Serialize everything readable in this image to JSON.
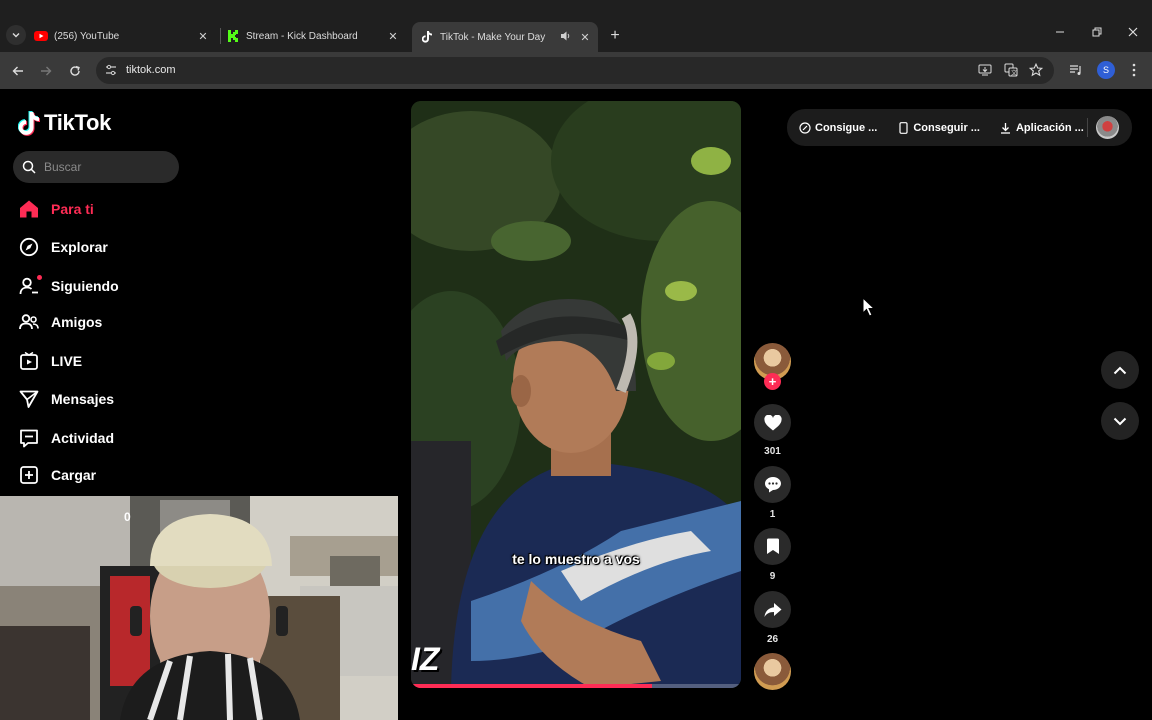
{
  "browser": {
    "tabs": [
      {
        "title": "(256) YouTube",
        "favicon": "youtube-icon",
        "color": "#ff0000"
      },
      {
        "title": "Stream - Kick Dashboard",
        "favicon": "kick-icon",
        "color": "#53fc18"
      },
      {
        "title": "TikTok - Make Your Day",
        "favicon": "tiktok-icon",
        "color": "#ffffff",
        "active": true
      }
    ],
    "url": "tiktok.com",
    "profile_initial": "S"
  },
  "sidebar": {
    "logo_text": "TikTok",
    "search_placeholder": "Buscar",
    "items": [
      {
        "label": "Para ti",
        "icon": "home-icon",
        "active": true
      },
      {
        "label": "Explorar",
        "icon": "compass-icon"
      },
      {
        "label": "Siguiendo",
        "icon": "following-icon"
      },
      {
        "label": "Amigos",
        "icon": "friends-icon"
      },
      {
        "label": "LIVE",
        "icon": "live-icon"
      },
      {
        "label": "Mensajes",
        "icon": "messages-icon"
      },
      {
        "label": "Actividad",
        "icon": "activity-icon"
      },
      {
        "label": "Cargar",
        "icon": "upload-icon"
      }
    ]
  },
  "webcam": {
    "counter": "0"
  },
  "video": {
    "caption": "te lo muestro a vos",
    "brand_mark": "IZ",
    "progress": 0.73
  },
  "actions": {
    "likes": "301",
    "comments": "1",
    "saves": "9",
    "shares": "26"
  },
  "header": {
    "items": [
      {
        "label": "Consigue ...",
        "icon": "coin-icon"
      },
      {
        "label": "Conseguir ...",
        "icon": "phone-icon"
      },
      {
        "label": "Aplicación ...",
        "icon": "download-icon"
      }
    ]
  },
  "colors": {
    "accent": "#fe2c55",
    "background": "#000000"
  }
}
